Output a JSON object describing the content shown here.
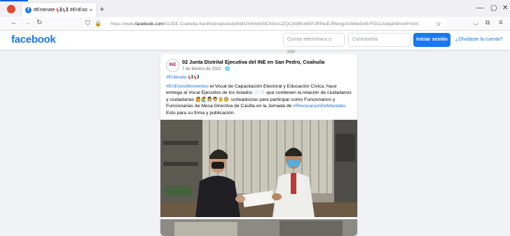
{
  "browser": {
    "tab_title": "#Enterate 📢📢 #EnEstosMom",
    "tab_close": "×",
    "new_tab": "+",
    "url_prefix": "https://www.",
    "url_host": "facebook.com",
    "url_path": "/02JDE.Coahuila.SanPedro/posts/pfbid02mN54SNCNGmJZQCjWjf6i34EF2RfNuEJRbzqp3UM4eDnErFDCcAvkjahBhreRYkml",
    "window_controls": [
      "—",
      "▢",
      "✕"
    ],
    "icons": {
      "back": "back-arrow-icon",
      "forward": "forward-arrow-icon",
      "reload": "reload-icon",
      "shield": "shield-icon",
      "lock": "lock-icon",
      "star": "star-icon",
      "pocket": "pocket-icon",
      "extensions": "extensions-icon",
      "menu": "menu-icon"
    }
  },
  "header": {
    "logo": "facebook",
    "email_placeholder": "Correo electrónico o telé",
    "password_placeholder": "Contraseña",
    "login_label": "Iniciar sesión",
    "forgot_label": "¿Olvidaste la cuenta?",
    "brand_color": "#1877f2"
  },
  "post": {
    "avatar_text": "INE",
    "page_name": "02 Junta Distrital Ejecutiva del INE en San Pedro, Coahuila",
    "date": "7 de febrero de 2022 · 🌐",
    "line1_tag": "#Enterate",
    "line1_emoji": "📢📢",
    "p_tag1": "#EnEstosMomentos",
    "p_text1": " el Vocal de Capacitación Electoral y Educación Cívica, hace entrega al Vocal Ejecutivo de los listados ",
    "p_emoji1": "📄📄",
    "p_text2": " que contienen la relación de ciudadanos y ciudadanas ",
    "p_emoji2": "🙋🙋‍♂️👩‍💼🧑‍💼👵🧓",
    "p_text3": " sorteados/as para participar como Funcionarios y Funcionarias de Mesa Directiva de Casilla en la Jornada de ",
    "p_tag2": "#RevocacionDeMandato",
    "p_text4": ". Esto para su firma y publicación."
  }
}
